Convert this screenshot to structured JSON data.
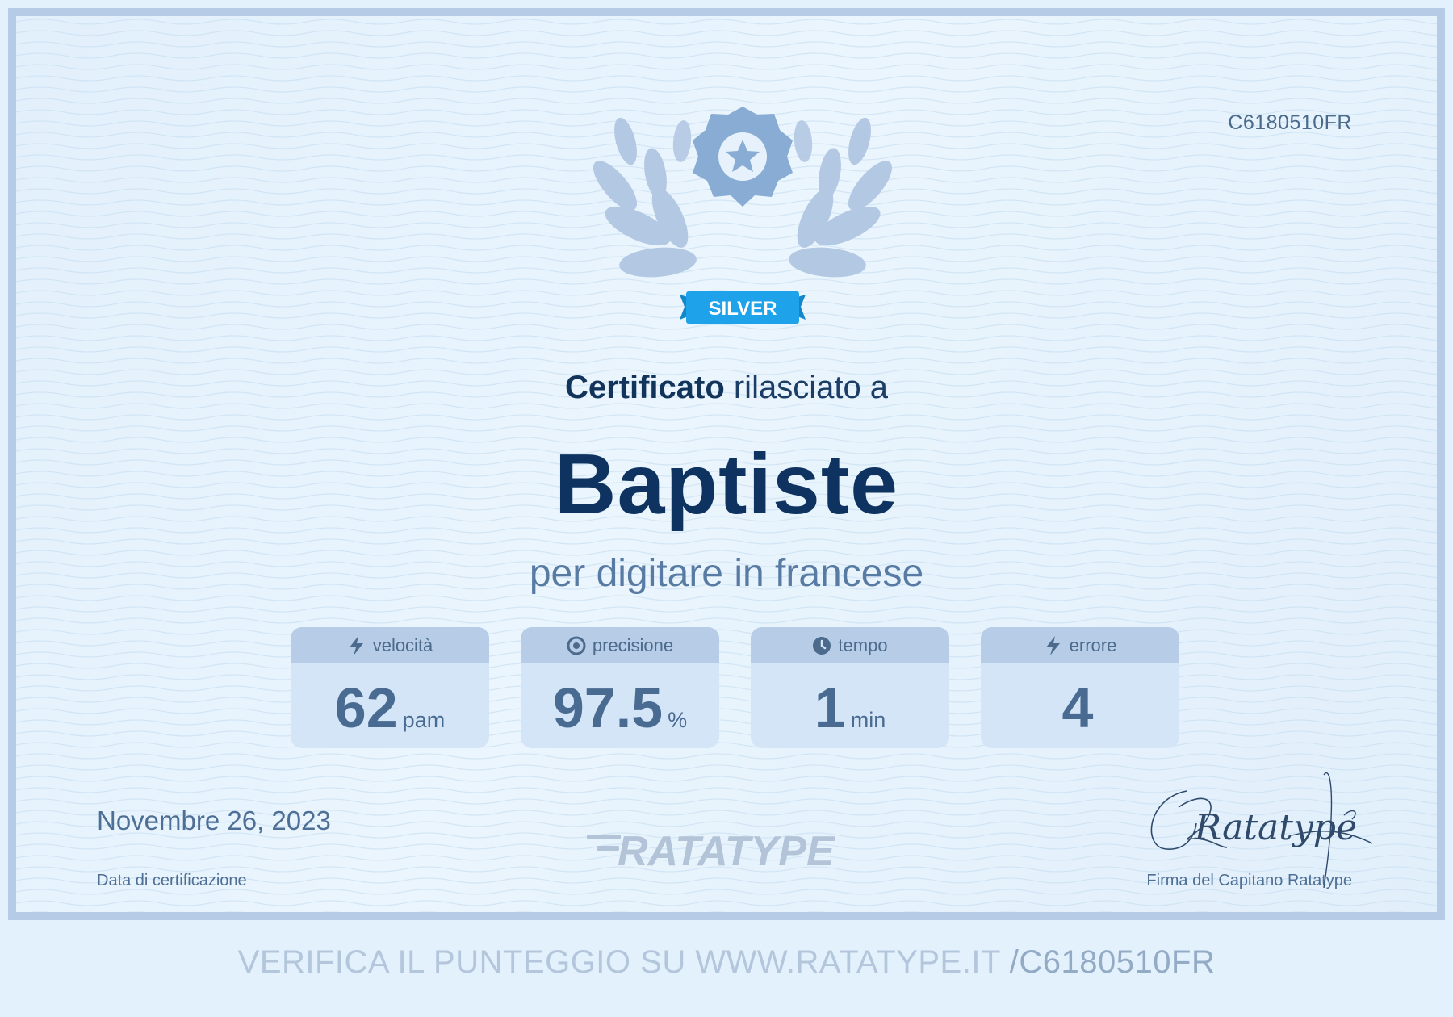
{
  "certificate": {
    "code": "C6180510FR",
    "badge": "SILVER",
    "issued_bold": "Certificato",
    "issued_rest": " rilasciato a",
    "recipient": "Baptiste",
    "subject": "per digitare in francese"
  },
  "stats": [
    {
      "label": "velocità",
      "value": "62",
      "unit": "pam",
      "icon": "lightning-icon"
    },
    {
      "label": "precisione",
      "value": "97.5",
      "unit": "%",
      "icon": "target-icon"
    },
    {
      "label": "tempo",
      "value": "1",
      "unit": "min",
      "icon": "clock-icon"
    },
    {
      "label": "errore",
      "value": "4",
      "unit": "",
      "icon": "lightning-icon"
    }
  ],
  "footer": {
    "date": "Novembre 26, 2023",
    "date_label": "Data di certificazione",
    "logo_text": "RATATYPE",
    "signature_text": "Ratatype",
    "signature_label": "Firma del Capitano Ratatype"
  },
  "verify": {
    "text": "VERIFICA IL PUNTEGGIO SU WWW.RATATYPE.IT",
    "code": "/C6180510FR"
  },
  "colors": {
    "badge": "#1ea3ea",
    "emblem": "#88acd3",
    "laurel": "#b3c8e3",
    "title": "#0f3360",
    "stat_head": "#b7cde7",
    "stat_body": "#d3e5f7"
  }
}
